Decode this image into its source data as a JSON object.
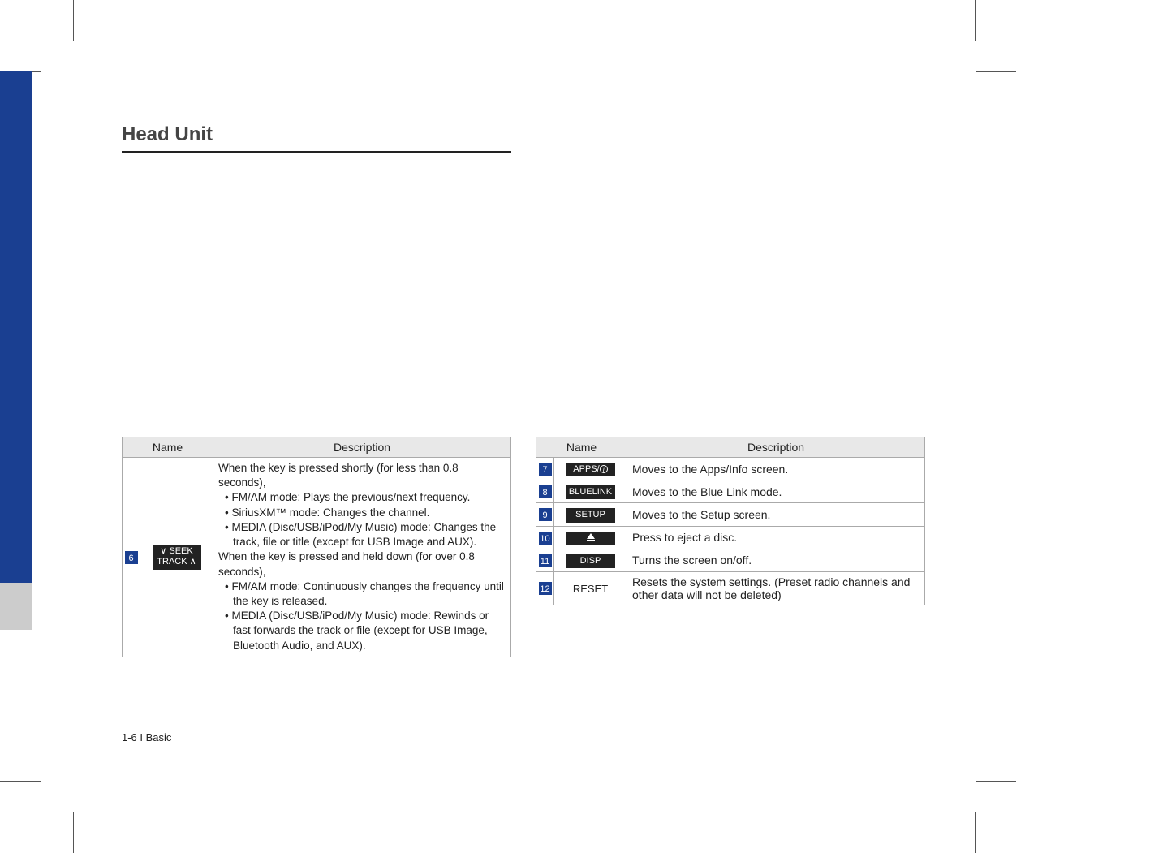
{
  "section_title": "Head Unit",
  "footer": "1-6 I Basic",
  "table_left": {
    "headers": {
      "name": "Name",
      "desc": "Description"
    },
    "row": {
      "num": "6",
      "name_line1": "∨ SEEK",
      "name_line2": "TRACK ∧",
      "desc_short_intro": "When the key is pressed shortly (for less than 0.8 seconds),",
      "desc_short_b1": "FM/AM mode: Plays the previous/next frequency.",
      "desc_short_b2": "SiriusXM™ mode: Changes the channel.",
      "desc_short_b3": "MEDIA (Disc/USB/iPod/My Music) mode: Changes the track, file or title (except for USB Image and AUX).",
      "desc_long_intro": "When the key is pressed and held down (for over 0.8 seconds),",
      "desc_long_b1": "FM/AM mode: Continuously changes the frequency until the key is released.",
      "desc_long_b2": "MEDIA (Disc/USB/iPod/My Music) mode: Rewinds or fast forwards the track or file (except for USB Image, Bluetooth Audio, and AUX)."
    }
  },
  "table_right": {
    "headers": {
      "name": "Name",
      "desc": "Description"
    },
    "rows": [
      {
        "num": "7",
        "name": "APPS/ⓘ",
        "name_type": "apps",
        "desc": "Moves to the Apps/Info screen."
      },
      {
        "num": "8",
        "name": "BLUELINK",
        "name_type": "btn",
        "desc": "Moves to the Blue Link mode."
      },
      {
        "num": "9",
        "name": "SETUP",
        "name_type": "btn",
        "desc": "Moves to the Setup screen."
      },
      {
        "num": "10",
        "name": "eject",
        "name_type": "eject",
        "desc": "Press to eject a disc."
      },
      {
        "num": "11",
        "name": "DISP",
        "name_type": "btn",
        "desc": "Turns the screen on/off."
      },
      {
        "num": "12",
        "name": "RESET",
        "name_type": "plain",
        "desc": "Resets the system settings. (Preset radio channels and other data will not be deleted)"
      }
    ]
  }
}
